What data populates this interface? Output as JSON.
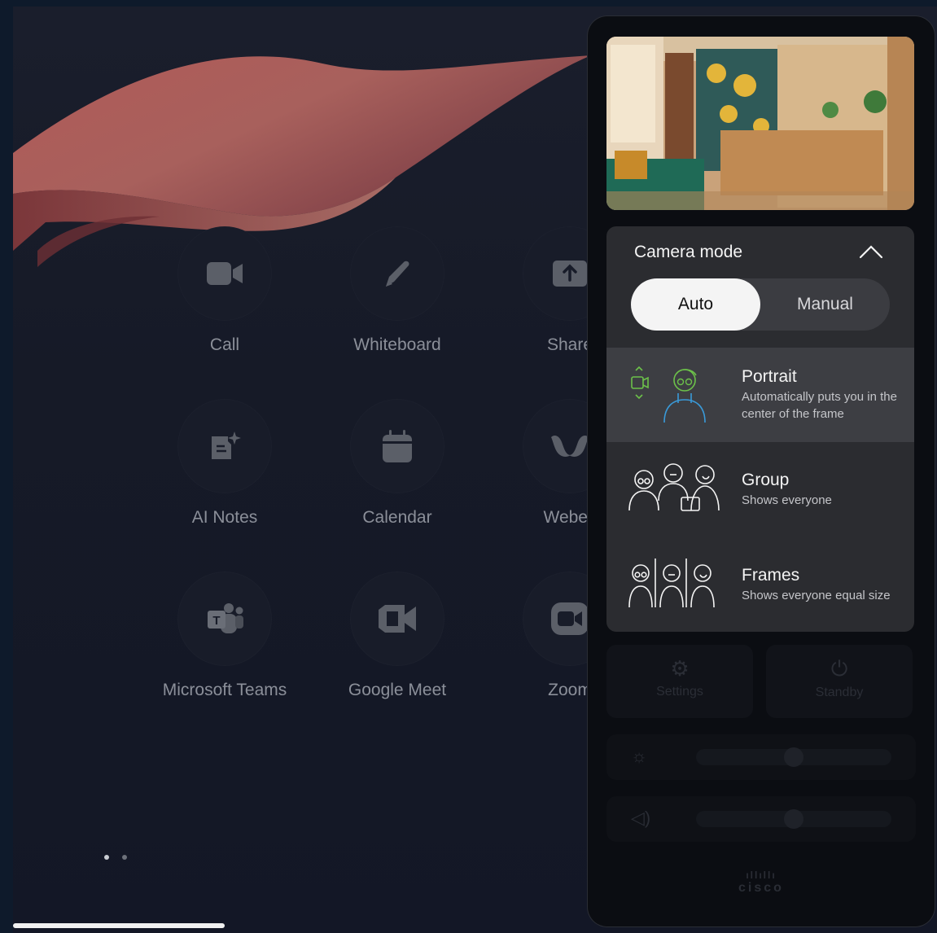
{
  "apps": [
    {
      "label": "Call",
      "icon": "video-camera-icon"
    },
    {
      "label": "Whiteboard",
      "icon": "pen-icon"
    },
    {
      "label": "Share",
      "icon": "share-upload-icon"
    },
    {
      "label": "AI Notes",
      "icon": "ai-notes-icon"
    },
    {
      "label": "Calendar",
      "icon": "calendar-icon"
    },
    {
      "label": "Webex",
      "icon": "webex-logo-icon"
    },
    {
      "label": "Microsoft Teams",
      "icon": "microsoft-teams-icon"
    },
    {
      "label": "Google Meet",
      "icon": "google-meet-icon"
    },
    {
      "label": "Zoom",
      "icon": "zoom-icon"
    }
  ],
  "pagination": {
    "pages": 2,
    "current": 1
  },
  "camera_panel": {
    "title": "Camera mode",
    "segment": {
      "options": [
        "Auto",
        "Manual"
      ],
      "selected": "Auto"
    },
    "modes": [
      {
        "name": "Portrait",
        "description": "Automatically puts you in the center of the frame",
        "selected": true
      },
      {
        "name": "Group",
        "description": "Shows everyone",
        "selected": false
      },
      {
        "name": "Frames",
        "description": "Shows everyone equal size",
        "selected": false
      }
    ]
  },
  "background_controls": {
    "settings_label": "Settings",
    "standby_label": "Standby",
    "brightness_level": 0.5,
    "volume_level": 0.5,
    "brand": "cisco"
  },
  "colors": {
    "accent_green": "#6cc04a",
    "accent_blue": "#3a9ad9",
    "panel_bg": "#2b2c30",
    "selected_row": "#3d3e43"
  }
}
